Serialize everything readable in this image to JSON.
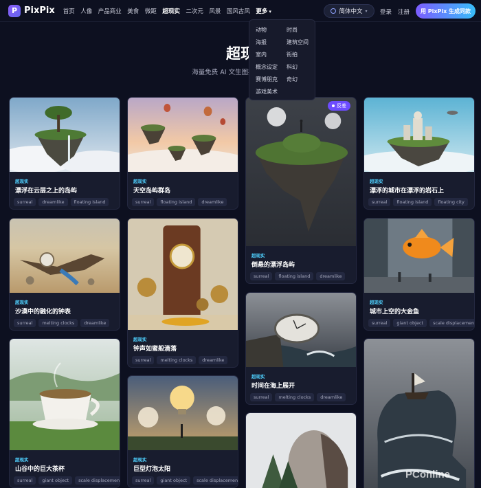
{
  "brand": {
    "name": "PixPix",
    "mark": "P"
  },
  "nav": {
    "items": [
      "首页",
      "人像",
      "产品商业",
      "美食",
      "微距",
      "超现实",
      "二次元",
      "风景",
      "国风古风",
      "更多"
    ],
    "active": "超现实",
    "language": "简体中文",
    "login": "登录",
    "signup": "注册",
    "cta": "用 PixPix 生成同款"
  },
  "more_menu": {
    "left": [
      "动物",
      "海报",
      "室内",
      "概念设定",
      "赛博朋克",
      "游戏美术"
    ],
    "right": [
      "时尚",
      "建筑空间",
      "街拍",
      "科幻",
      "奇幻"
    ]
  },
  "hero": {
    "title": "超现",
    "subtitle": "海量免费 AI 文生图提示词 · … 感"
  },
  "cards": [
    {
      "category": "超现实",
      "title": "漂浮在云层之上的岛屿",
      "tags": [
        "surreal",
        "dreamlike",
        "floating island"
      ]
    },
    {
      "category": "超现实",
      "title": "天空岛屿群岛",
      "tags": [
        "surreal",
        "floating island",
        "dreamlike"
      ]
    },
    {
      "category": "超现实",
      "title": "倒悬的漂浮岛屿",
      "tags": [
        "surreal",
        "floating island",
        "dreamlike"
      ],
      "badge": "反差"
    },
    {
      "category": "超现实",
      "title": "漂浮的城市在漂浮的岩石上",
      "tags": [
        "surreal",
        "floating island",
        "floating city"
      ]
    },
    {
      "category": "超现实",
      "title": "沙漠中的融化的钟表",
      "tags": [
        "surreal",
        "melting clocks",
        "dreamlike"
      ]
    },
    {
      "category": "超现实",
      "title": "钟声如蜜般滴落",
      "tags": [
        "surreal",
        "melting clocks",
        "dreamlike"
      ]
    },
    {
      "category": "超现实",
      "title": "时间在海上展开",
      "tags": [
        "surreal",
        "melting clocks",
        "dreamlike"
      ]
    },
    {
      "category": "超现实",
      "title": "城市上空的大金鱼",
      "tags": [
        "surreal",
        "giant object",
        "scale displacement"
      ]
    },
    {
      "category": "超现实",
      "title": "山谷中的巨大茶杯",
      "tags": [
        "surreal",
        "giant object",
        "scale displacement"
      ]
    },
    {
      "category": "超现实",
      "title": "巨型灯泡太阳",
      "tags": [
        "surreal",
        "giant object",
        "scale displacement"
      ]
    },
    {
      "category": "",
      "title": "",
      "tags": []
    },
    {
      "category": "",
      "title": "",
      "tags": []
    }
  ],
  "watermark": "PConline"
}
